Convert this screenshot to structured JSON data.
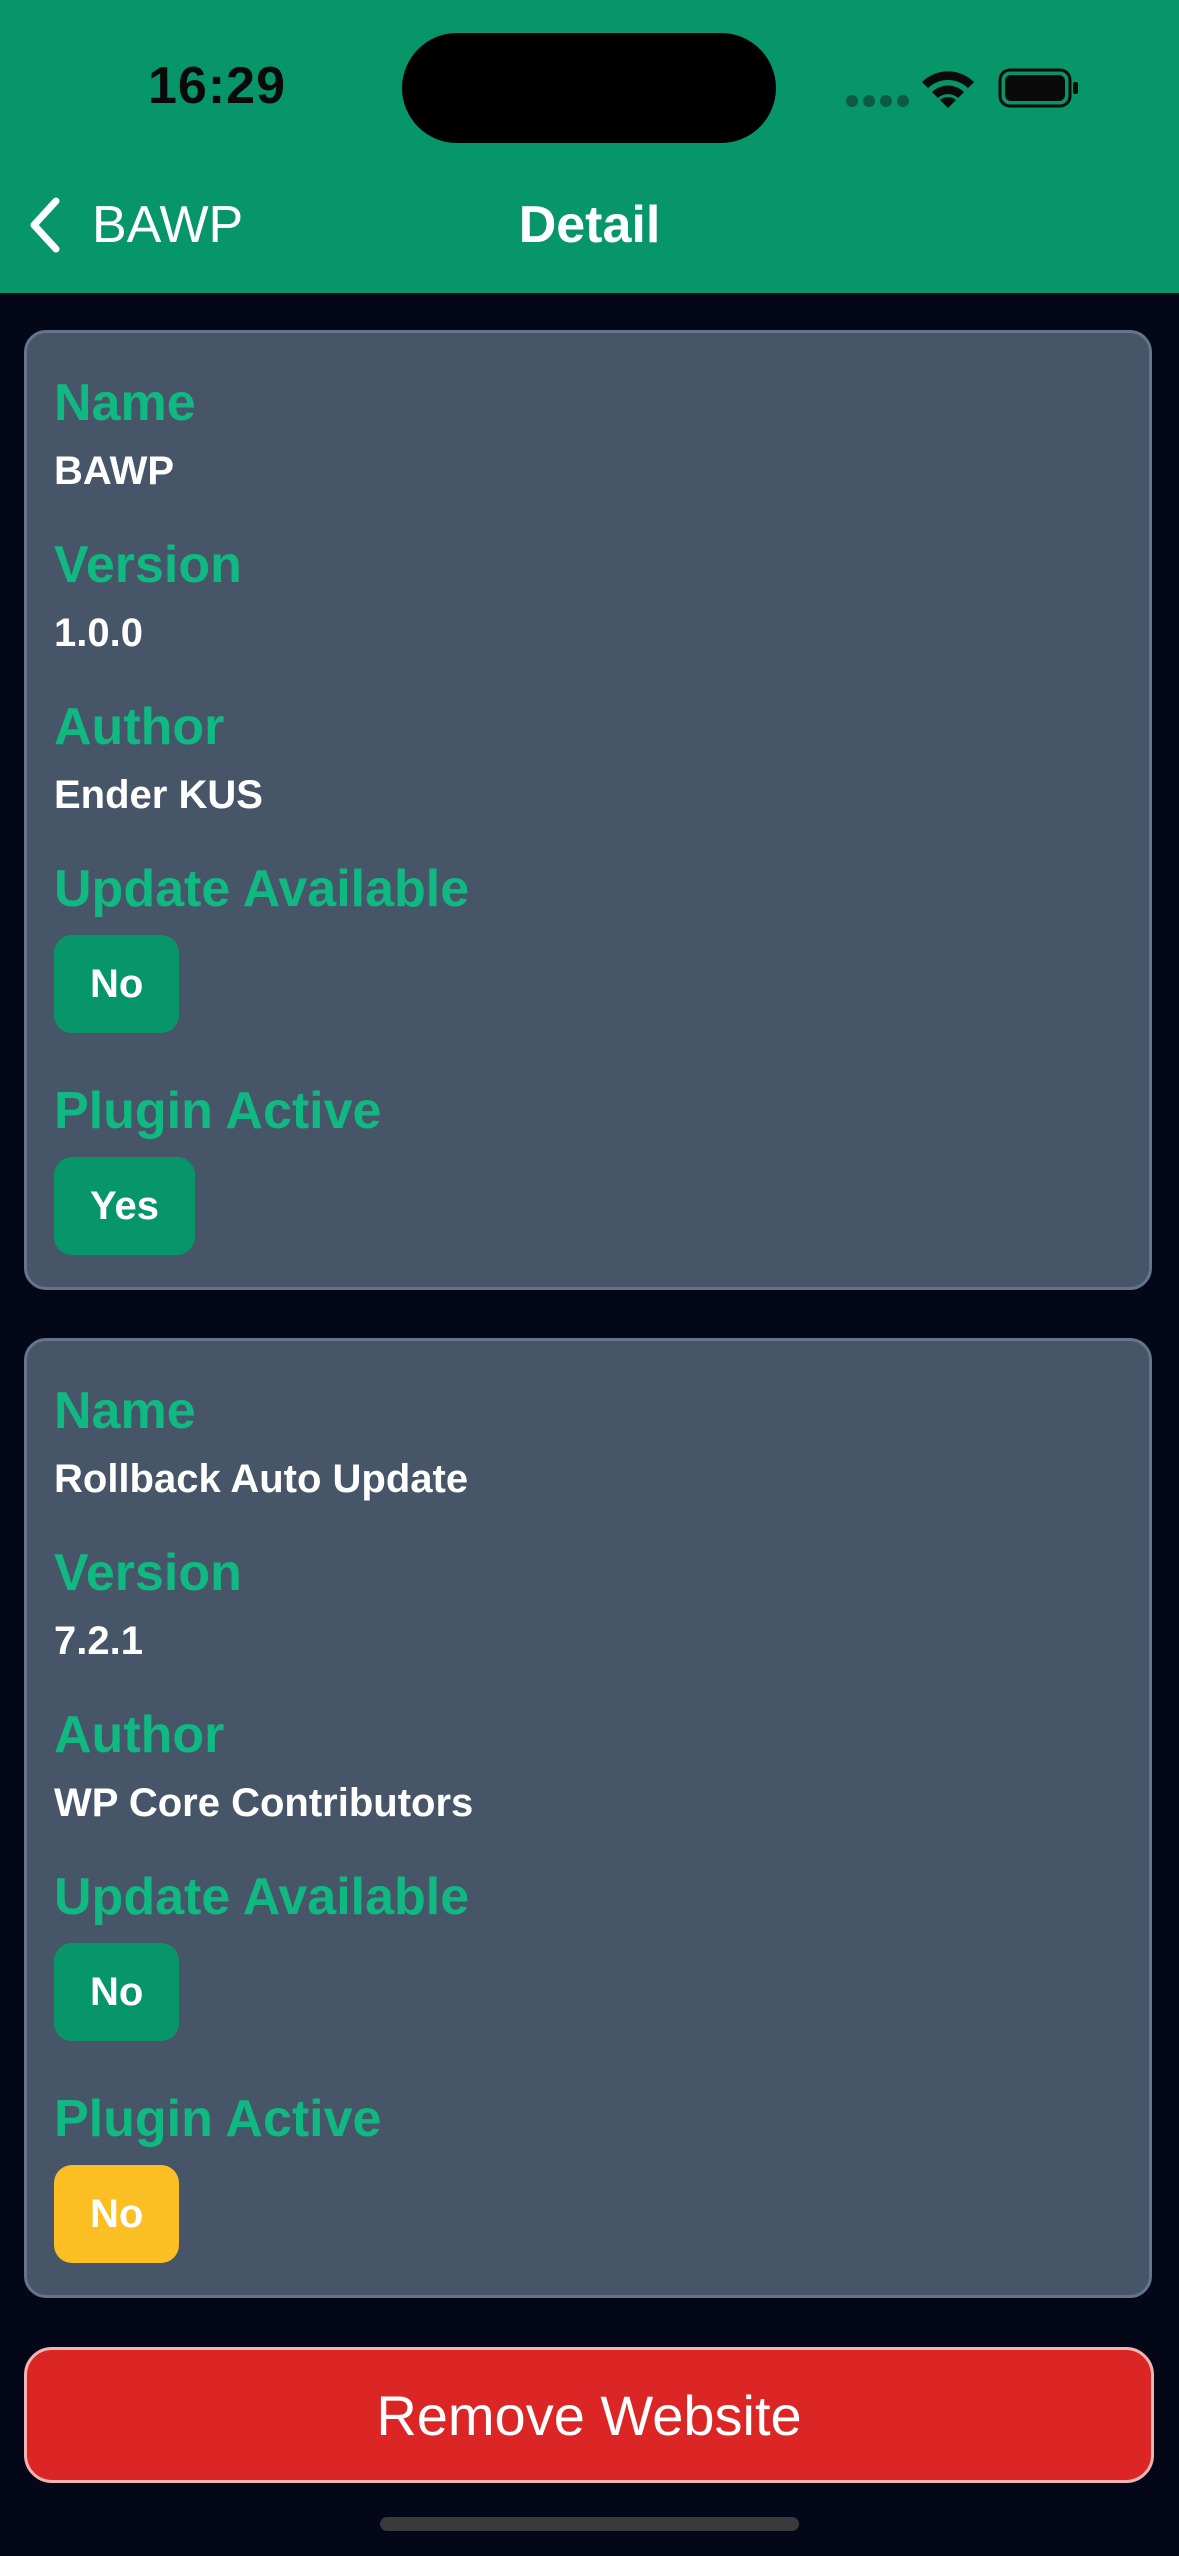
{
  "status_bar": {
    "time": "16:29"
  },
  "nav": {
    "back_label": "BAWP",
    "title": "Detail"
  },
  "plugins": [
    {
      "name_label": "Name",
      "name": "BAWP",
      "version_label": "Version",
      "version": "1.0.0",
      "author_label": "Author",
      "author": "Ender KUS",
      "update_label": "Update Available",
      "update": "No",
      "active_label": "Plugin Active",
      "active": "Yes"
    },
    {
      "name_label": "Name",
      "name": "Rollback Auto Update",
      "version_label": "Version",
      "version": "7.2.1",
      "author_label": "Author",
      "author": "WP Core Contributors",
      "update_label": "Update Available",
      "update": "No",
      "active_label": "Plugin Active",
      "active": "No"
    }
  ],
  "actions": {
    "remove_label": "Remove Website"
  },
  "colors": {
    "header": "#079669",
    "accent": "#10b981",
    "card": "#475569",
    "badge_green": "#079669",
    "badge_yellow": "#fbbf24",
    "danger": "#dc2626",
    "background": "#030718"
  }
}
